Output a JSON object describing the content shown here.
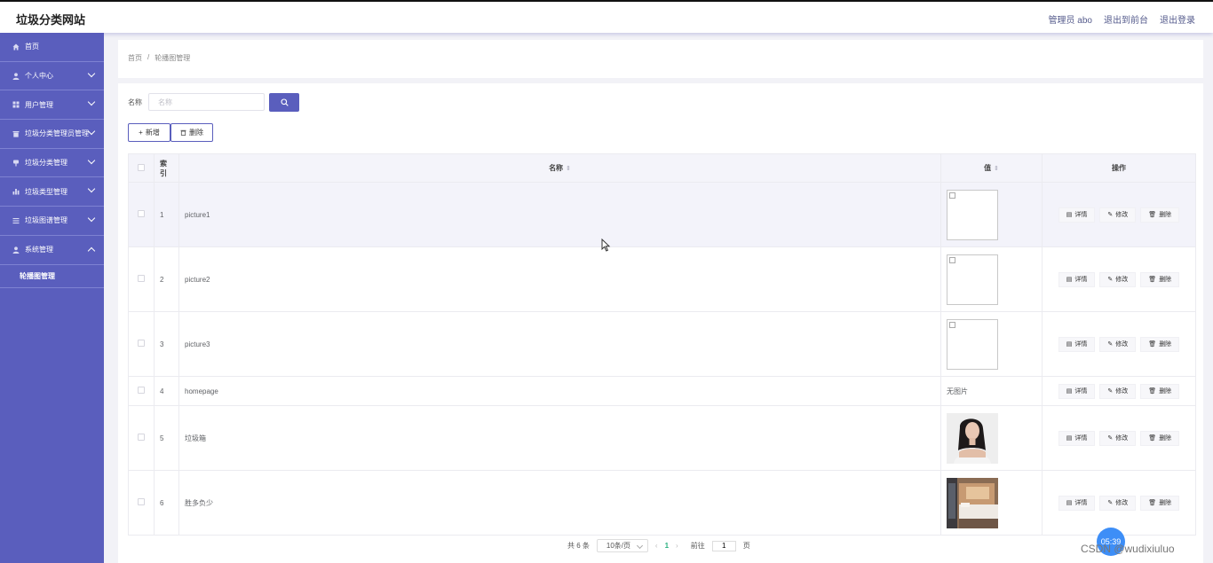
{
  "app": {
    "title": "垃圾分类网站"
  },
  "header_links": [
    "管理员 abo",
    "退出到前台",
    "退出登录"
  ],
  "sidebar": {
    "items": [
      {
        "label": "首页",
        "icon": "home-icon",
        "expandable": false
      },
      {
        "label": "个人中心",
        "icon": "user-icon",
        "expandable": true
      },
      {
        "label": "用户管理",
        "icon": "grid-icon",
        "expandable": true
      },
      {
        "label": "垃圾分类管理员管理",
        "icon": "trash-icon",
        "expandable": true
      },
      {
        "label": "垃圾分类管理",
        "icon": "pin-icon",
        "expandable": true
      },
      {
        "label": "垃圾类型管理",
        "icon": "bar-chart-icon",
        "expandable": true
      },
      {
        "label": "垃圾图谱管理",
        "icon": "list-icon",
        "expandable": true
      },
      {
        "label": "系统管理",
        "icon": "user-icon",
        "expandable": true,
        "expanded": true
      }
    ],
    "subitems": [
      "轮播图管理"
    ]
  },
  "breadcrumb": {
    "home": "首页",
    "separator": "/",
    "current": "轮播图管理"
  },
  "search": {
    "label": "名称",
    "placeholder": "名称",
    "value": ""
  },
  "toolbar": {
    "add_label": "新增",
    "delete_label": "删除"
  },
  "table": {
    "columns": {
      "index": "索引",
      "name": "名称",
      "value": "值",
      "actions": "操作"
    },
    "rows": [
      {
        "index": "1",
        "name": "picture1",
        "value_type": "broken"
      },
      {
        "index": "2",
        "name": "picture2",
        "value_type": "broken"
      },
      {
        "index": "3",
        "name": "picture3",
        "value_type": "broken"
      },
      {
        "index": "4",
        "name": "homepage",
        "value_type": "text",
        "value_text": "无图片"
      },
      {
        "index": "5",
        "name": "垃圾箱",
        "value_type": "portrait"
      },
      {
        "index": "6",
        "name": "胜多负少",
        "value_type": "room"
      }
    ],
    "actions": {
      "detail": "详情",
      "edit": "修改",
      "delete": "删除"
    }
  },
  "pagination": {
    "total_text": "共 6 条",
    "page_size": "10条/页",
    "current_page": "1",
    "goto_label": "前往",
    "goto_value": "1",
    "page_suffix": "页"
  },
  "overlay": {
    "clock": "05:39",
    "watermark": "CSDN @wudixiuluo"
  },
  "colors": {
    "accent": "#5a5ebd",
    "sidebar_bg": "#5a5ebd",
    "page_active": "#2ab07f"
  }
}
